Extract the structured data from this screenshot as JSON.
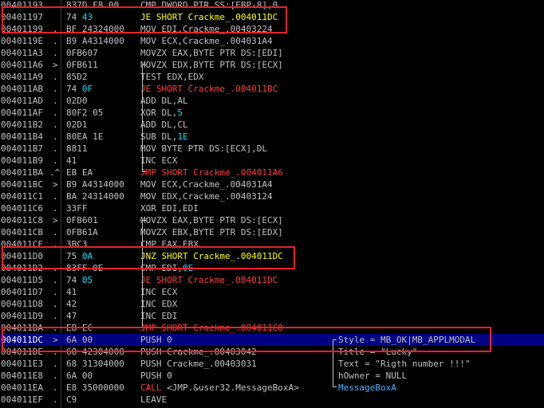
{
  "colors": {
    "background": "#000000",
    "text": "#c0c0c0",
    "jump": "#ff3b3b",
    "jcc": "#ffff00",
    "call": "#ff3b3b",
    "operand_number": "#00e0ff",
    "constant_blue": "#4fb3ff",
    "selection": "#000080",
    "highlight_box": "#e8212b"
  },
  "rows": [
    {
      "addr": "00401193",
      "sep": ".",
      "bytes": "837D F8 00",
      "dis": [
        [
          "CMP DWORD PTR SS:[EBP-8],0",
          "txt"
        ]
      ]
    },
    {
      "addr": "00401197",
      "sep": " ",
      "bytes": "74 43",
      "dis": [
        [
          "JE SHORT Crackme_.004011DC",
          "jcc"
        ]
      ]
    },
    {
      "addr": "00401199",
      "sep": ".",
      "bytes": "BF 24324000",
      "dis": [
        [
          "MOV EDI,Crackme_.00403224",
          "txt"
        ]
      ]
    },
    {
      "addr": "0040119E",
      "sep": ".",
      "bytes": "B9 A4314000",
      "dis": [
        [
          "MOV ECX,Crackme_.004031A4",
          "txt"
        ]
      ]
    },
    {
      "addr": "004011A3",
      "sep": ".",
      "bytes": "0FB607",
      "dis": [
        [
          "MOVZX EAX,BYTE PTR DS:[EDI]",
          "txt"
        ]
      ]
    },
    {
      "addr": "004011A6",
      "sep": ">",
      "bytes": "0FB611",
      "dis": [
        [
          "MOVZX EDX,BYTE PTR DS:[ECX]",
          "txt"
        ]
      ]
    },
    {
      "addr": "004011A9",
      "sep": ".",
      "bytes": "85D2",
      "dis": [
        [
          "TEST EDX,EDX",
          "txt"
        ]
      ]
    },
    {
      "addr": "004011AB",
      "sep": ".",
      "bytes": "74 0F",
      "dis": [
        [
          "JE SHORT Crackme_.004011BC",
          "jmp"
        ]
      ]
    },
    {
      "addr": "004011AD",
      "sep": ".",
      "bytes": "02D0",
      "dis": [
        [
          "ADD DL,AL",
          "txt"
        ]
      ]
    },
    {
      "addr": "004011AF",
      "sep": ".",
      "bytes": "80F2 05",
      "dis": [
        [
          "XOR DL,",
          "txt"
        ],
        [
          "5",
          "num"
        ]
      ]
    },
    {
      "addr": "004011B2",
      "sep": ".",
      "bytes": "02D1",
      "dis": [
        [
          "ADD DL,CL",
          "txt"
        ]
      ]
    },
    {
      "addr": "004011B4",
      "sep": ".",
      "bytes": "80EA 1E",
      "dis": [
        [
          "SUB DL,",
          "txt"
        ],
        [
          "1E",
          "num"
        ]
      ]
    },
    {
      "addr": "004011B7",
      "sep": ".",
      "bytes": "8811",
      "dis": [
        [
          "MOV BYTE PTR DS:[ECX],DL",
          "txt"
        ]
      ]
    },
    {
      "addr": "004011B9",
      "sep": ".",
      "bytes": "41",
      "dis": [
        [
          "INC ECX",
          "txt"
        ]
      ]
    },
    {
      "addr": "004011BA",
      "sep": ".^",
      "bytes": "EB EA",
      "dis": [
        [
          "JMP SHORT Crackme_.004011A6",
          "jmp"
        ]
      ]
    },
    {
      "addr": "004011BC",
      "sep": ">",
      "bytes": "B9 A4314000",
      "dis": [
        [
          "MOV ECX,Crackme_.004031A4",
          "txt"
        ]
      ]
    },
    {
      "addr": "004011C1",
      "sep": ".",
      "bytes": "BA 24314000",
      "dis": [
        [
          "MOV EDX,Crackme_.00403124",
          "txt"
        ]
      ]
    },
    {
      "addr": "004011C6",
      "sep": ".",
      "bytes": "33FF",
      "dis": [
        [
          "XOR EDI,EDI",
          "txt"
        ]
      ]
    },
    {
      "addr": "004011C8",
      "sep": ">",
      "bytes": "0FB601",
      "dis": [
        [
          "MOVZX EAX,BYTE PTR DS:[ECX]",
          "txt"
        ]
      ]
    },
    {
      "addr": "004011CB",
      "sep": ".",
      "bytes": "0FB61A",
      "dis": [
        [
          "MOVZX EBX,BYTE PTR DS:[EDX]",
          "txt"
        ]
      ]
    },
    {
      "addr": "004011CE",
      "sep": ".",
      "bytes": "3BC3",
      "dis": [
        [
          "CMP EAX,EBX",
          "txt"
        ]
      ]
    },
    {
      "addr": "004011D0",
      "sep": " ",
      "bytes": "75 0A",
      "dis": [
        [
          "JNZ SHORT Crackme_.004011DC",
          "jcc"
        ]
      ]
    },
    {
      "addr": "004011D2",
      "sep": ".",
      "bytes": "83FF 0E",
      "dis": [
        [
          "CMP EDI,",
          "txt"
        ],
        [
          "0E",
          "num"
        ]
      ]
    },
    {
      "addr": "004011D5",
      "sep": ".",
      "bytes": "74 05",
      "dis": [
        [
          "JE SHORT Crackme_.004011DC",
          "jmp"
        ]
      ]
    },
    {
      "addr": "004011D7",
      "sep": ".",
      "bytes": "41",
      "dis": [
        [
          "INC ECX",
          "txt"
        ]
      ]
    },
    {
      "addr": "004011D8",
      "sep": ".",
      "bytes": "42",
      "dis": [
        [
          "INC EDX",
          "txt"
        ]
      ]
    },
    {
      "addr": "004011D9",
      "sep": ".",
      "bytes": "47",
      "dis": [
        [
          "INC EDI",
          "txt"
        ]
      ]
    },
    {
      "addr": "004011DA",
      "sep": ".",
      "bytes": "EB EC",
      "dis": [
        [
          "JMP SHORT Crackme_.004011C8",
          "jmp"
        ]
      ]
    },
    {
      "addr": "004011DC",
      "sep": ">",
      "bytes": "6A 00",
      "dis": [
        [
          "PUSH 0",
          "txt"
        ]
      ],
      "comment": "Style = MB_OK|MB_APPLMODAL",
      "selected": true
    },
    {
      "addr": "004011DE",
      "sep": ".",
      "bytes": "68 42304000",
      "dis": [
        [
          "PUSH Crackme_.00403042",
          "txt"
        ]
      ],
      "comment": "Title = \"Lucky\""
    },
    {
      "addr": "004011E3",
      "sep": ".",
      "bytes": "68 31304000",
      "dis": [
        [
          "PUSH Crackme_.00403031",
          "txt"
        ]
      ],
      "comment": "Text = \"Rigth number !!!\""
    },
    {
      "addr": "004011E8",
      "sep": ".",
      "bytes": "6A 00",
      "dis": [
        [
          "PUSH 0",
          "txt"
        ]
      ],
      "comment": "hOwner = NULL"
    },
    {
      "addr": "004011EA",
      "sep": ".",
      "bytes": "E8 35000000",
      "dis": [
        [
          "CALL ",
          "call"
        ],
        [
          "<JMP.&user32.MessageBoxA>",
          "txt"
        ]
      ],
      "comment": "MessageBoxA",
      "comment_style": "blue"
    },
    {
      "addr": "004011EF",
      "sep": ".",
      "bytes": "C9",
      "dis": [
        [
          "LEAVE",
          "txt"
        ]
      ]
    }
  ]
}
